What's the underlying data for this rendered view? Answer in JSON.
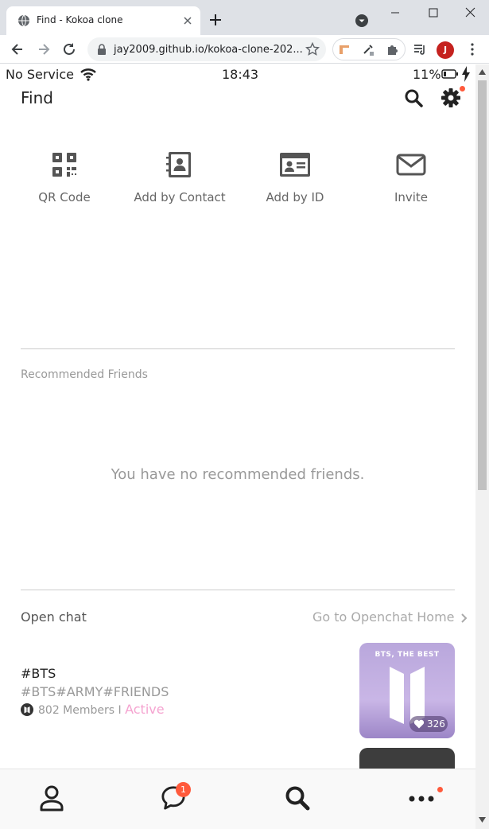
{
  "browser": {
    "tab_title": "Find - Kokoa clone",
    "url": "jay2009.github.io/kokoa-clone-202...",
    "profile_initial": "J"
  },
  "status_bar": {
    "carrier": "No Service",
    "time": "18:43",
    "battery": "11%"
  },
  "header": {
    "title": "Find"
  },
  "actions": [
    {
      "label": "QR Code",
      "icon": "qr-code-icon"
    },
    {
      "label": "Add by Contact",
      "icon": "address-book-icon"
    },
    {
      "label": "Add by ID",
      "icon": "id-card-icon"
    },
    {
      "label": "Invite",
      "icon": "envelope-icon"
    }
  ],
  "recommended": {
    "title": "Recommended Friends",
    "empty_message": "You have no recommended friends."
  },
  "open_chat": {
    "title": "Open chat",
    "link": "Go to Openchat Home",
    "room": {
      "name": "#BTS",
      "tags": "#BTS#ARMY#FRIENDS",
      "members": "802 Members I",
      "status": "Active",
      "thumbnail_text": "BTS, THE BEST",
      "likes": "326"
    }
  },
  "tabbar": {
    "chat_badge": "1"
  },
  "colors": {
    "badge": "#ff5a3c",
    "active": "#f5a3d0",
    "icon": "#555555"
  }
}
